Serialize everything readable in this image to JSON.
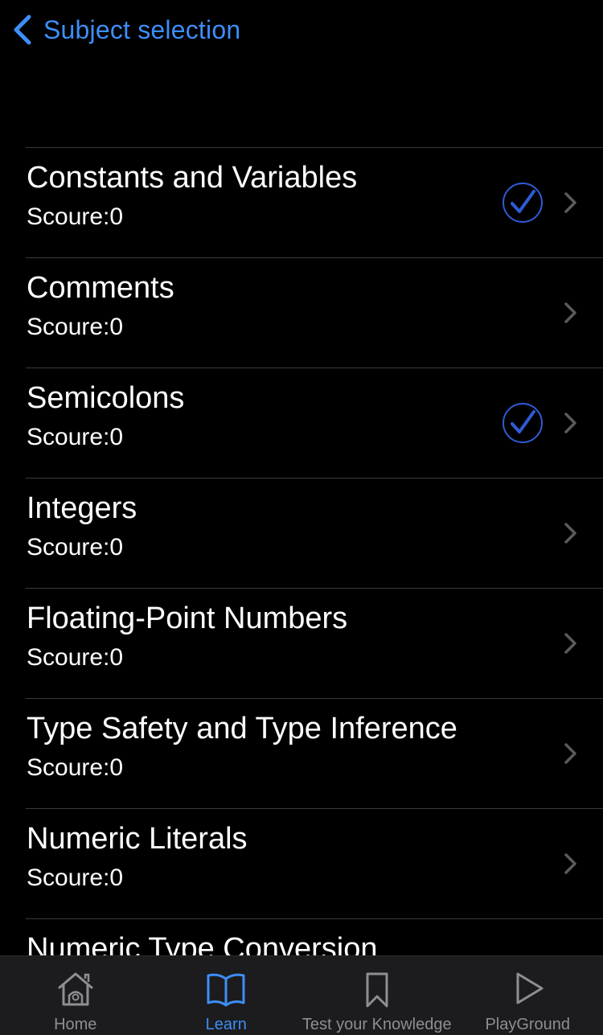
{
  "nav": {
    "back_label": "Subject selection"
  },
  "items": [
    {
      "title": "Constants and Variables",
      "subtitle": "Scoure:0",
      "checked": true
    },
    {
      "title": "Comments",
      "subtitle": "Scoure:0",
      "checked": false
    },
    {
      "title": "Semicolons",
      "subtitle": "Scoure:0",
      "checked": true
    },
    {
      "title": "Integers",
      "subtitle": "Scoure:0",
      "checked": false
    },
    {
      "title": "Floating-Point Numbers",
      "subtitle": "Scoure:0",
      "checked": false
    },
    {
      "title": "Type Safety and Type Inference",
      "subtitle": "Scoure:0",
      "checked": false
    },
    {
      "title": "Numeric Literals",
      "subtitle": "Scoure:0",
      "checked": false
    },
    {
      "title": "Numeric Type Conversion",
      "subtitle": "",
      "checked": false
    }
  ],
  "tabs": [
    {
      "label": "Home",
      "icon": "home-icon",
      "active": false
    },
    {
      "label": "Learn",
      "icon": "book-icon",
      "active": true
    },
    {
      "label": "Test your Knowledge",
      "icon": "bookmark-icon",
      "active": false
    },
    {
      "label": "PlayGround",
      "icon": "play-icon",
      "active": false
    }
  ],
  "colors": {
    "accent": "#3d8ef7",
    "check": "#2f5bd6",
    "inactive_tab": "#8e8e93",
    "background": "#000000",
    "tab_bar": "#1c1c1e",
    "separator": "#3a3a3c"
  }
}
